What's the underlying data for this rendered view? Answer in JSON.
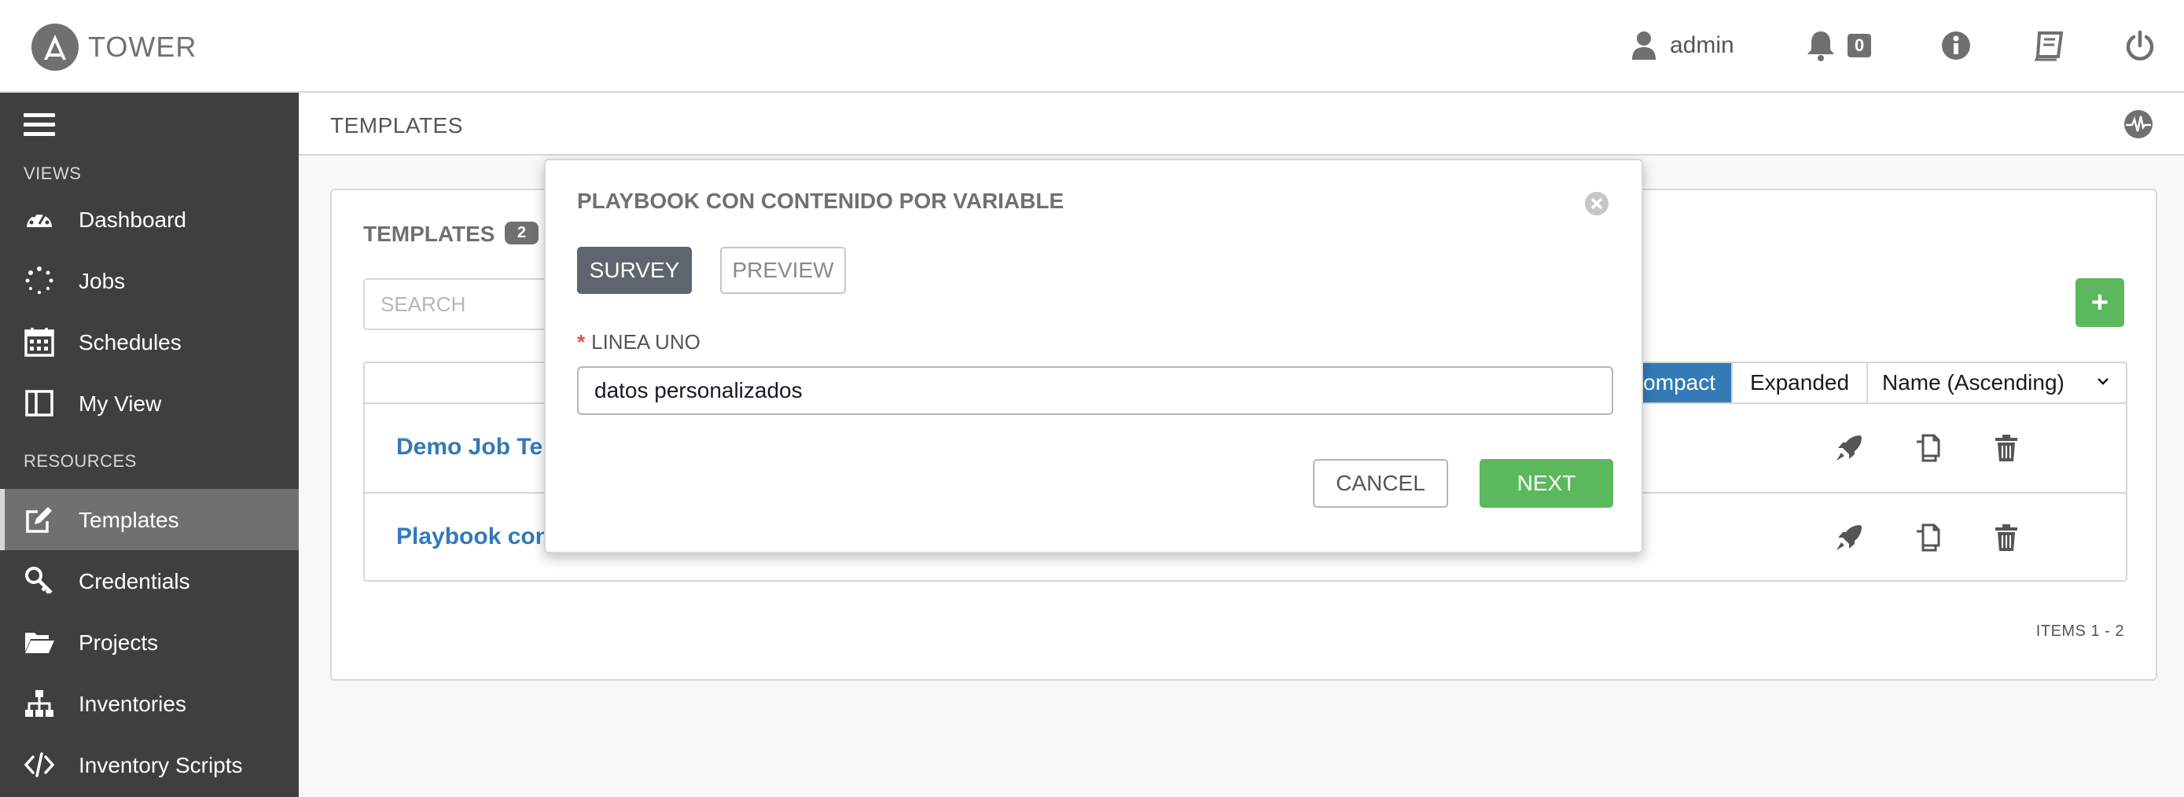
{
  "app": {
    "logo_text": "TOWER",
    "user_name": "admin",
    "notification_count": "0"
  },
  "sidebar": {
    "views_label": "VIEWS",
    "resources_label": "RESOURCES",
    "items": [
      {
        "label": "Dashboard",
        "icon": "dashboard-icon"
      },
      {
        "label": "Jobs",
        "icon": "jobs-icon"
      },
      {
        "label": "Schedules",
        "icon": "calendar-icon"
      },
      {
        "label": "My View",
        "icon": "my-view-icon"
      },
      {
        "label": "Templates",
        "icon": "edit-icon",
        "active": true
      },
      {
        "label": "Credentials",
        "icon": "key-icon"
      },
      {
        "label": "Projects",
        "icon": "folder-icon"
      },
      {
        "label": "Inventories",
        "icon": "sitemap-icon"
      },
      {
        "label": "Inventory Scripts",
        "icon": "code-icon"
      }
    ]
  },
  "breadcrumb": {
    "current": "TEMPLATES"
  },
  "panel": {
    "title": "TEMPLATES",
    "count": "2",
    "search_placeholder": "SEARCH",
    "add_label": "+",
    "view_toggle": {
      "compact": "Compact",
      "expanded": "Expanded"
    },
    "sort_label": "Name (Ascending)",
    "rows": [
      {
        "name": "Demo Job Template"
      },
      {
        "name": "Playbook con contenido por variable"
      }
    ],
    "items_label": "ITEMS  1 - 2"
  },
  "modal": {
    "title": "PLAYBOOK CON CONTENIDO POR VARIABLE",
    "tabs": {
      "survey": "SURVEY",
      "preview": "PREVIEW"
    },
    "field": {
      "required_mark": "*",
      "label": "LINEA UNO",
      "value": "datos personalizados"
    },
    "cancel_label": "CANCEL",
    "next_label": "NEXT"
  },
  "colors": {
    "sidebar_bg": "#3f3f3f",
    "active_item_bg": "#707070",
    "link_blue": "#337ab7",
    "success_green": "#5cb85c",
    "survey_tab": "#5e6570"
  }
}
